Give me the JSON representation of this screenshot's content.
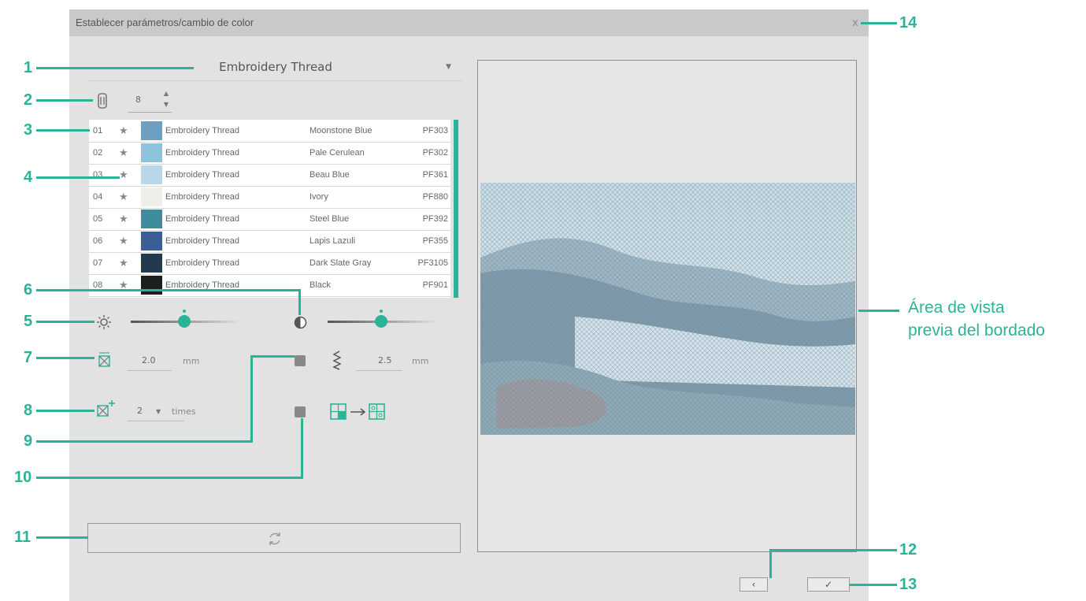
{
  "dialog": {
    "title": "Establecer parámetros/cambio de color",
    "close_label": "x"
  },
  "thread_select": {
    "value": "Embroidery Thread"
  },
  "thread_count": {
    "value": "8"
  },
  "threads": [
    {
      "num": "01",
      "brand": "Embroidery Thread",
      "name": "Moonstone Blue",
      "code": "PF303",
      "color": "#6f9fc0"
    },
    {
      "num": "02",
      "brand": "Embroidery Thread",
      "name": "Pale Cerulean",
      "code": "PF302",
      "color": "#8ec3e0"
    },
    {
      "num": "03",
      "brand": "Embroidery Thread",
      "name": "Beau Blue",
      "code": "PF361",
      "color": "#b9d6ea"
    },
    {
      "num": "04",
      "brand": "Embroidery Thread",
      "name": "Ivory",
      "code": "PF880",
      "color": "#eeeeea"
    },
    {
      "num": "05",
      "brand": "Embroidery Thread",
      "name": "Steel Blue",
      "code": "PF392",
      "color": "#3f8c9c"
    },
    {
      "num": "06",
      "brand": "Embroidery Thread",
      "name": "Lapis Lazuli",
      "code": "PF355",
      "color": "#3b5e96"
    },
    {
      "num": "07",
      "brand": "Embroidery Thread",
      "name": "Dark Slate Gray",
      "code": "PF3105",
      "color": "#23394f"
    },
    {
      "num": "08",
      "brand": "Embroidery Thread",
      "name": "Black",
      "code": "PF901",
      "color": "#1e1e1e"
    }
  ],
  "brightness": {
    "level": 0.5
  },
  "contrast": {
    "level": 0.5
  },
  "stitch_size": {
    "value": "2.0",
    "unit": "mm"
  },
  "run_pitch": {
    "value": "2.5",
    "unit": "mm"
  },
  "repeat": {
    "value": "2",
    "unit": "times"
  },
  "preview_label": {
    "line1": "Área de vista",
    "line2": "previa del bordado"
  },
  "callouts": [
    "1",
    "2",
    "3",
    "4",
    "5",
    "6",
    "7",
    "8",
    "9",
    "10",
    "11",
    "12",
    "13",
    "14"
  ],
  "accent_color": "#2bb398",
  "icons": {
    "thread_count": "thread-spool-icon",
    "brightness": "sun-icon",
    "contrast": "contrast-icon",
    "stitch_size": "cross-stitch-size-icon",
    "run_pitch": "zigzag-icon",
    "repeat": "cross-stitch-add-icon",
    "convert": "grid-convert-icon",
    "refresh": "refresh-icon",
    "back": "chevron-left-icon",
    "ok": "check-icon"
  }
}
